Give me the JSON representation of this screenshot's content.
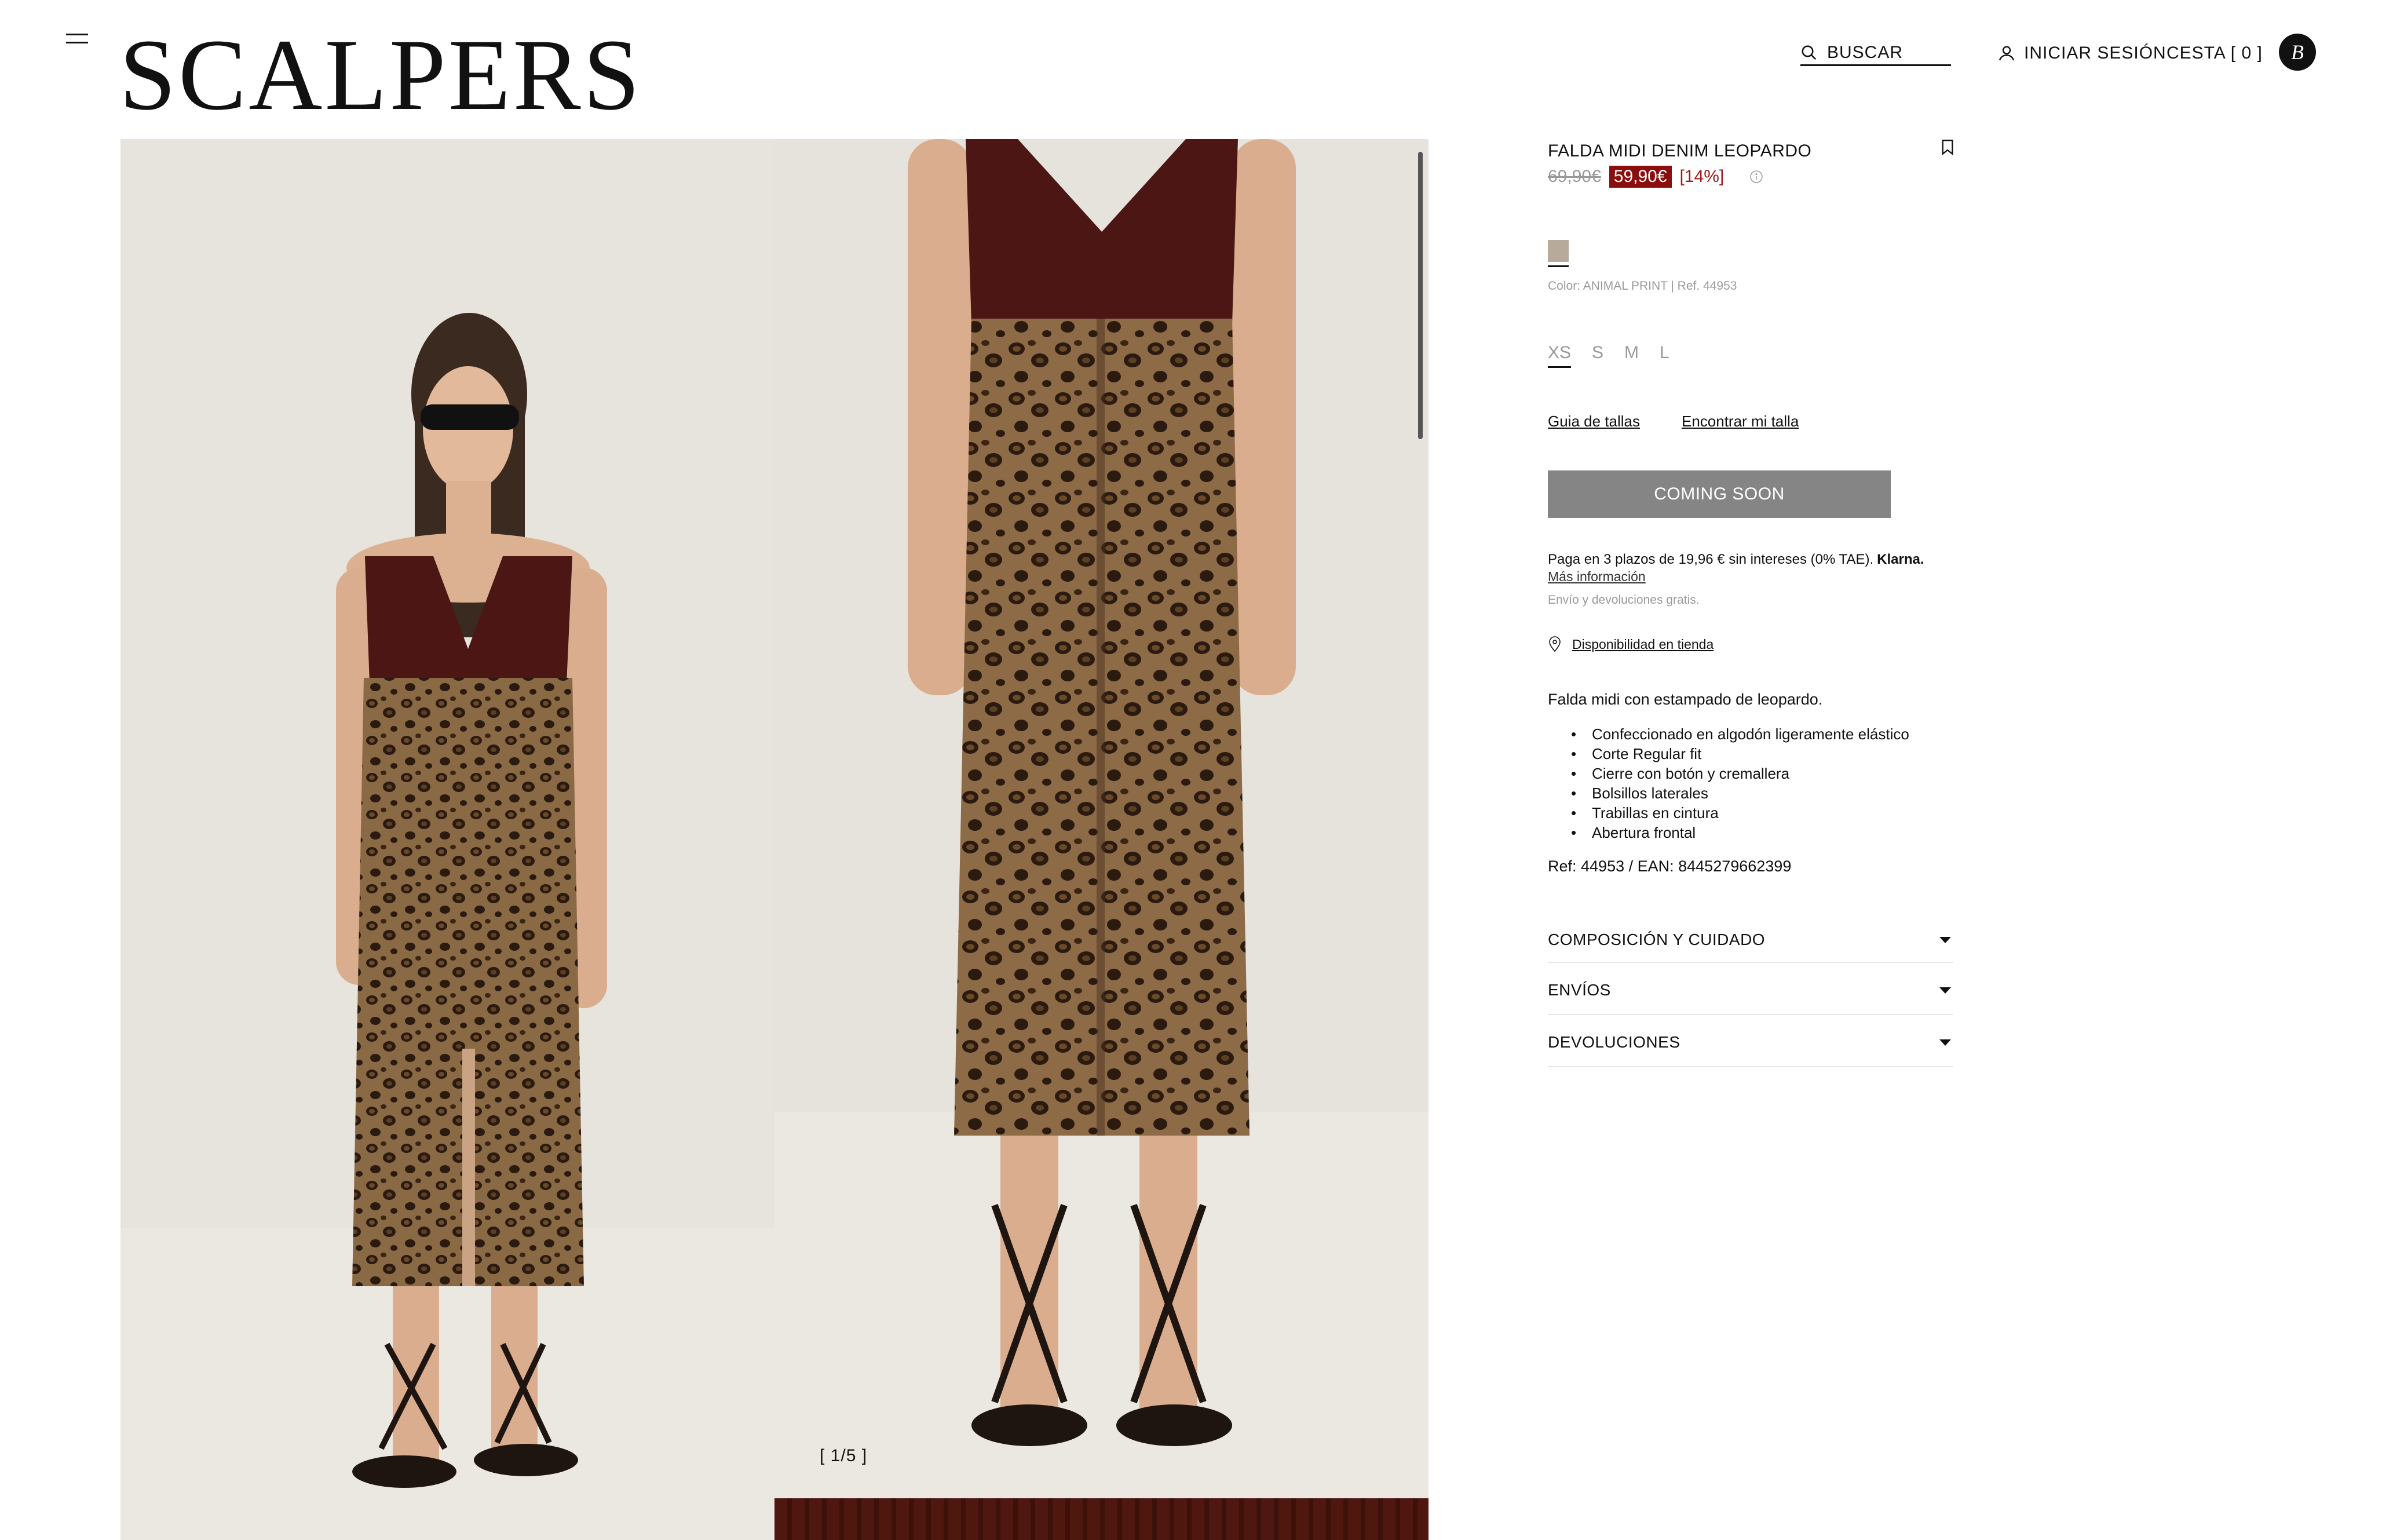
{
  "header": {
    "logo": "SCALPERS",
    "search_label": "BUSCAR",
    "login_label": "INICIAR SESIÓN",
    "cart_label": "CESTA",
    "cart_count": "[ 0 ]",
    "brand_badge": "B"
  },
  "gallery": {
    "counter": "[ 1/5 ]"
  },
  "product": {
    "title": "FALDA MIDI DENIM LEOPARDO",
    "old_price": "69,90€",
    "new_price": "59,90€",
    "discount": "[14%]",
    "color_info": "Color: ANIMAL PRINT | Ref. 44953",
    "swatch_color": "#b8aa9b",
    "sizes": [
      "XS",
      "S",
      "M",
      "L"
    ],
    "size_guide": "Guia de tallas",
    "find_size": "Encontrar mi talla",
    "cta": "COMING SOON",
    "klarna_text": "Paga en 3 plazos de 19,96 € sin intereses (0% TAE).",
    "klarna_brand": "Klarna.",
    "more_info": "Más información",
    "shipping_note": "Envío y devoluciones gratis.",
    "store_availability": "Disponibilidad en tienda",
    "description": "Falda midi con estampado de leopardo.",
    "features": [
      "Confeccionado en algodón ligeramente elástico",
      "Corte Regular fit",
      "Cierre con botón y cremallera",
      "Bolsillos laterales",
      "Trabillas en cintura",
      "Abertura frontal"
    ],
    "ref_line": "Ref: 44953 / EAN: 8445279662399",
    "accordion": [
      "COMPOSICIÓN Y CUIDADO",
      "ENVÍOS",
      "DEVOLUCIONES"
    ]
  },
  "colors": {
    "sale_red": "#8b0e0e",
    "cta_gray": "#858585"
  }
}
